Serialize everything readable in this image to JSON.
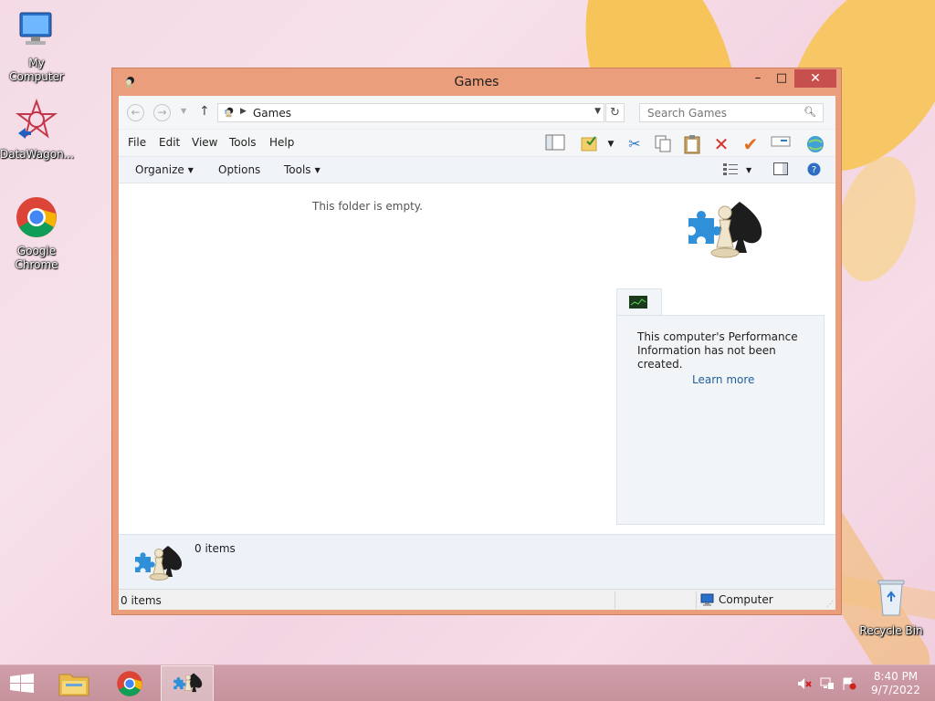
{
  "desktop": {
    "icons": [
      {
        "label": "My Computer",
        "icon": "computer-icon"
      },
      {
        "label": "DataWagon...",
        "icon": "datawagon-icon"
      },
      {
        "label": "Google\nChrome",
        "icon": "chrome-icon"
      },
      {
        "label": "Recycle Bin",
        "icon": "recycle-bin-icon"
      }
    ]
  },
  "window": {
    "title": "Games",
    "controls": {
      "minimize": "–",
      "maximize": "□",
      "close": "✕"
    },
    "address": {
      "crumb": "Games"
    },
    "search": {
      "placeholder": "Search Games"
    },
    "menu": [
      "File",
      "Edit",
      "View",
      "Tools",
      "Help"
    ],
    "commands": {
      "organize": "Organize",
      "options": "Options",
      "tools": "Tools"
    },
    "content": {
      "empty_message": "This folder is empty."
    },
    "performance": {
      "message": "This computer's Performance Information has not been created.",
      "link": "Learn more"
    },
    "details": {
      "count": "0 items"
    },
    "status": {
      "left": "0 items",
      "right": "Computer"
    }
  },
  "taskbar": {
    "time": "8:40 PM",
    "date": "9/7/2022"
  },
  "colors": {
    "window_frame": "#eb9e7c",
    "close_button": "#c7504e",
    "link": "#1f5f9e",
    "taskbar": "#c6929d"
  }
}
